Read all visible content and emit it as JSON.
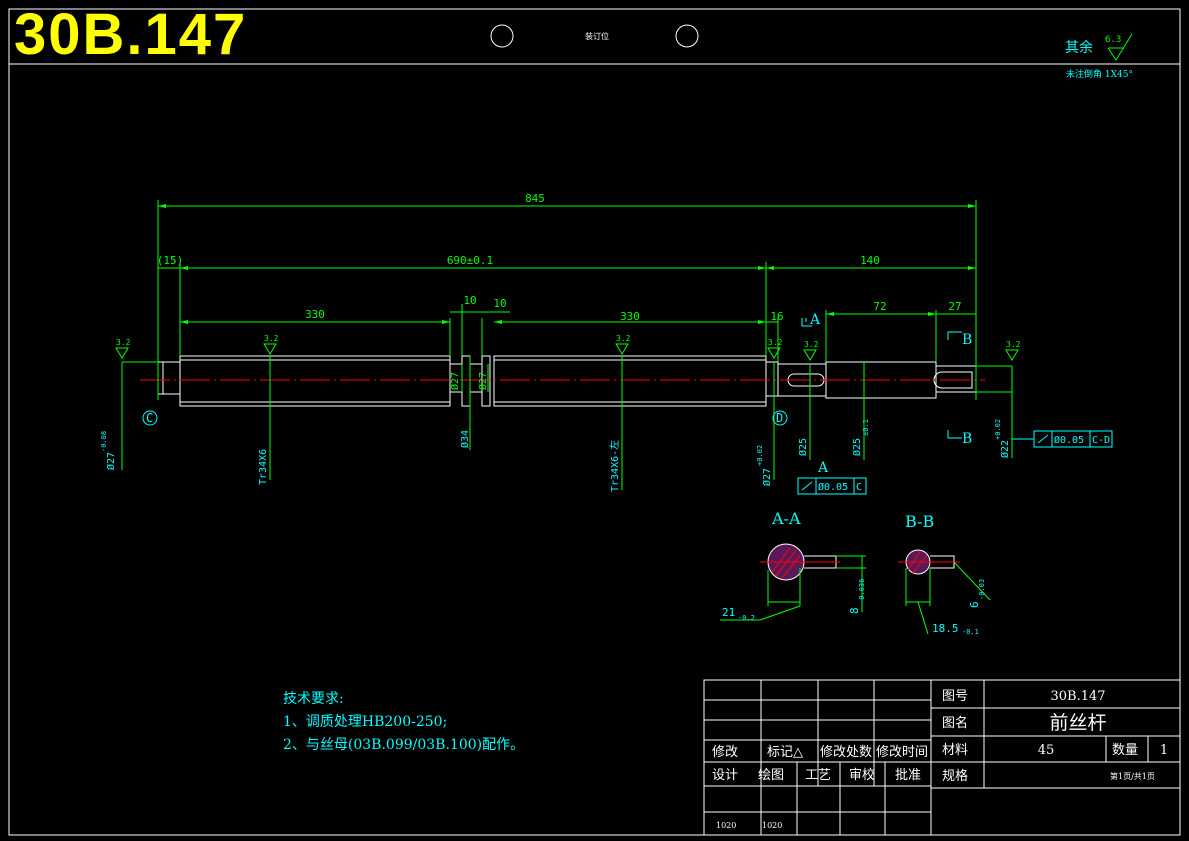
{
  "sheet": {
    "drawing_number_large": "30B.147",
    "binding_label": "装订位",
    "roughness": {
      "prefix": "其余",
      "value": "6.3"
    },
    "chamfer_note": "未注倒角 1X45°"
  },
  "colors": {
    "background": "#000000",
    "dimension": "#00ff00",
    "text": "#00ffff",
    "outline": "#ffffff",
    "centerline": "#ff0000",
    "title": "#ffff00"
  },
  "dimensions": {
    "overall": "845",
    "main": "690±0.1",
    "left_end": "(15)",
    "right_end": "140",
    "left_thread": "330",
    "right_thread": "330",
    "groove1": "10",
    "groove2": "10",
    "step16": "16",
    "seg72": "72",
    "seg27": "27",
    "dia_groove1": "Ø27",
    "dia_groove2": "Ø27",
    "dia_collar": "Ø34",
    "thread_left": "Tr34X6",
    "thread_right": "Tr34X6-左",
    "dia_left_end": "Ø27",
    "dia_d": "Ø27",
    "dia_shaft1": "Ø25",
    "dia_shaft2": "Ø25",
    "dia_right_end": "Ø22",
    "tol_minus": "-0.08",
    "tol_plus": "+0.02",
    "tol_mid": "±0.1"
  },
  "roughness_marks": [
    "3.2",
    "3.2",
    "3.2",
    "3.2",
    "3.2",
    "3.2"
  ],
  "datums": {
    "c": "C",
    "d": "D",
    "a": "A",
    "b": "B"
  },
  "fcf": {
    "c": {
      "tol": "Ø0.05",
      "datum": "C"
    },
    "d": {
      "tol": "Ø0.05",
      "datum": "C-D"
    }
  },
  "sections": {
    "aa": {
      "title": "A-A",
      "dim1": "21",
      "dim1_tol": "-0.2",
      "dim2": "8",
      "dim2_tol": "-0.036"
    },
    "bb": {
      "title": "B-B",
      "dim1": "18.5",
      "dim1_tol": "-0.1",
      "dim2": "6",
      "dim2_tol": "-0.03"
    }
  },
  "tech_requirements": {
    "heading": "技术要求:",
    "items": [
      "1、调质处理HB200-250;",
      "2、与丝母(03B.099/03B.100)配作。"
    ]
  },
  "title_block": {
    "drawing_no_label": "图号",
    "drawing_no": "30B.147",
    "name_label": "图名",
    "name": "前丝杆",
    "material_label": "材料",
    "material": "45",
    "qty_label": "数量",
    "qty": "1",
    "spec_label": "规格",
    "pages": "第1页/共1页",
    "rev_headers": [
      "修改",
      "标记△",
      "修改处数",
      "修改时间"
    ],
    "sign_headers": [
      "设计",
      "绘图",
      "工艺",
      "审校",
      "批准"
    ],
    "dates": [
      "1020",
      "1020"
    ]
  }
}
